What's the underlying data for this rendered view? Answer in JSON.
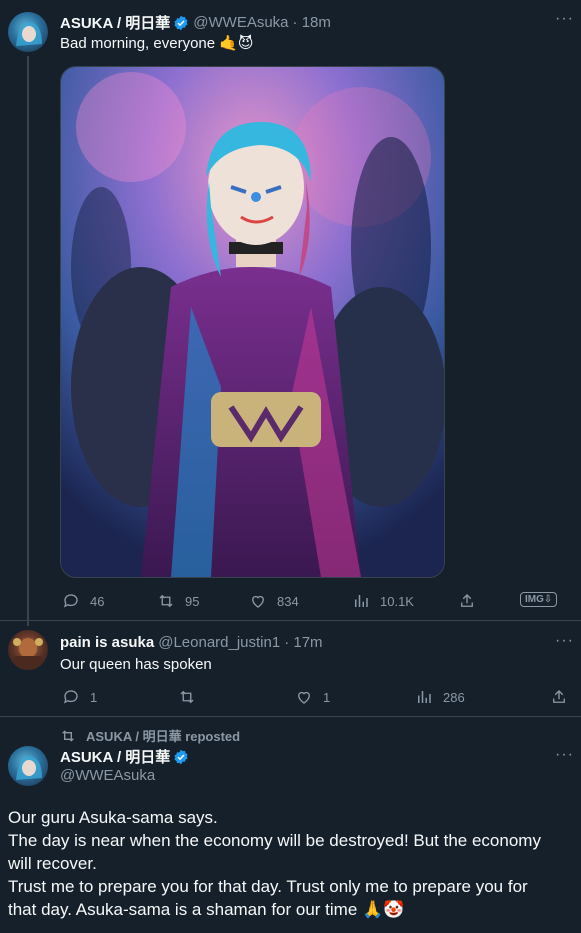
{
  "tweet1": {
    "display_name": "ASUKA / 明日華",
    "handle": "@WWEAsuka",
    "time": "· 18m",
    "text": "Bad morning, everyone 🤙😈",
    "stats": {
      "replies": "46",
      "reposts": "95",
      "likes": "834",
      "views": "10.1K"
    },
    "img_badge": "IMG⇩"
  },
  "reply": {
    "display_name": "pain is asuka",
    "handle": "@Leonard_justin1",
    "time": "· 17m",
    "text": "Our queen has spoken",
    "stats": {
      "replies": "1",
      "reposts": "",
      "likes": "1",
      "views": "286"
    }
  },
  "repost": {
    "label": "ASUKA / 明日華 reposted",
    "display_name": "ASUKA / 明日華",
    "handle": "@WWEAsuka",
    "lines": [
      "Our guru Asuka-sama says.",
      "The day is near when the economy will be destroyed! But the economy",
      "will recover.",
      "Trust me to prepare you for that day. Trust only me to prepare you for",
      "that day. Asuka-sama is a shaman for our time 🙏🤡"
    ]
  },
  "colors": {
    "background": "#15202b",
    "accent": "#1d9bf0",
    "muted": "#8b98a5",
    "border": "#38444d"
  }
}
